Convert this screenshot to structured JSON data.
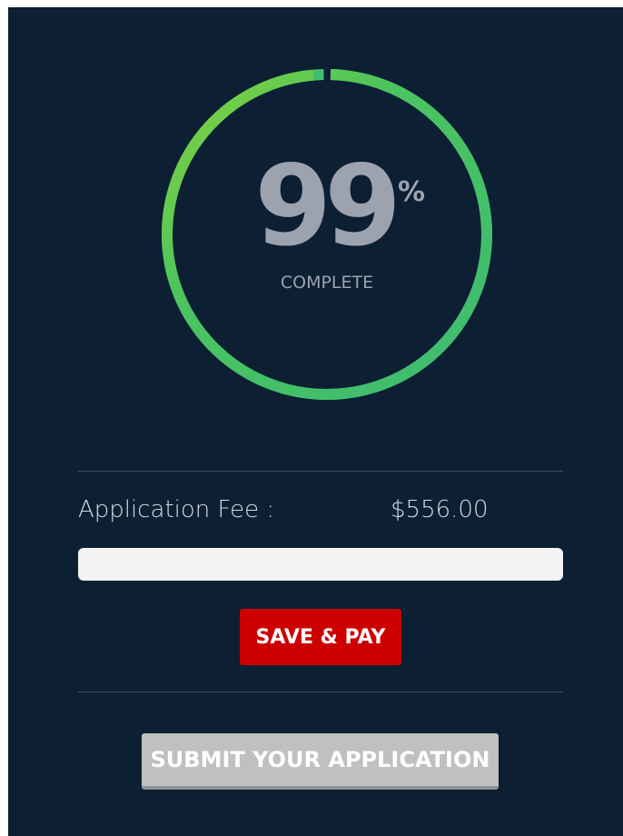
{
  "progress": {
    "value": 99,
    "number": "99",
    "unit": "%",
    "label": "COMPLETE",
    "track_color": "#3fbf6f",
    "highlight_color": "#7fd13b"
  },
  "fee": {
    "label": "Application Fee :",
    "amount": "$556.00",
    "input_value": ""
  },
  "buttons": {
    "save_pay": "SAVE & PAY",
    "submit": "SUBMIT YOUR APPLICATION"
  },
  "colors": {
    "background": "#0c1f33",
    "pay_button": "#cc0000",
    "submit_button": "#bfc0c1"
  }
}
